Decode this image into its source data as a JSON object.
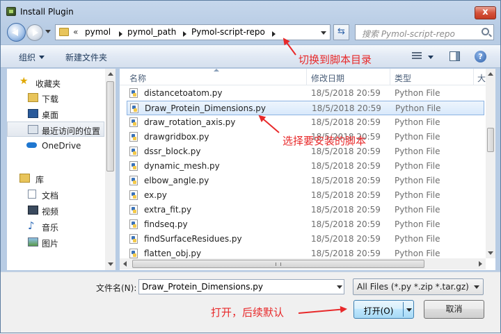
{
  "window": {
    "title": "Install Plugin",
    "close_label": "x"
  },
  "address": {
    "chevrons": "«",
    "crumbs": [
      "pymol",
      "pymol_path",
      "Pymol-script-repo"
    ],
    "search_placeholder": "搜索 Pymol-script-repo"
  },
  "toolbar": {
    "organize_label": "组织",
    "new_folder_label": "新建文件夹",
    "help_label": "?"
  },
  "sidebar": {
    "favorites": "收藏夹",
    "downloads": "下载",
    "desktop": "桌面",
    "recent": "最近访问的位置",
    "onedrive": "OneDrive",
    "libraries": "库",
    "documents": "文档",
    "videos": "视频",
    "music": "音乐",
    "pictures": "图片"
  },
  "columns": {
    "name": "名称",
    "date": "修改日期",
    "type": "类型",
    "size": "大"
  },
  "files": [
    {
      "name": "distancetoatom.py",
      "date": "18/5/2018 20:59",
      "type": "Python File"
    },
    {
      "name": "Draw_Protein_Dimensions.py",
      "date": "18/5/2018 20:59",
      "type": "Python File",
      "selected": true
    },
    {
      "name": "draw_rotation_axis.py",
      "date": "18/5/2018 20:59",
      "type": "Python File"
    },
    {
      "name": "drawgridbox.py",
      "date": "18/5/2018 20:59",
      "type": "Python File"
    },
    {
      "name": "dssr_block.py",
      "date": "18/5/2018 20:59",
      "type": "Python File"
    },
    {
      "name": "dynamic_mesh.py",
      "date": "18/5/2018 20:59",
      "type": "Python File"
    },
    {
      "name": "elbow_angle.py",
      "date": "18/5/2018 20:59",
      "type": "Python File"
    },
    {
      "name": "ex.py",
      "date": "18/5/2018 20:59",
      "type": "Python File"
    },
    {
      "name": "extra_fit.py",
      "date": "18/5/2018 20:59",
      "type": "Python File"
    },
    {
      "name": "findseq.py",
      "date": "18/5/2018 20:59",
      "type": "Python File"
    },
    {
      "name": "findSurfaceResidues.py",
      "date": "18/5/2018 20:59",
      "type": "Python File"
    },
    {
      "name": "flatten_obj.py",
      "date": "18/5/2018 20:59",
      "type": "Python File"
    }
  ],
  "bottom": {
    "filename_label": "文件名(N):",
    "filename_value": "Draw_Protein_Dimensions.py",
    "filter_value": "All Files (*.py *.zip *.tar.gz)",
    "open_label": "打开(O)",
    "cancel_label": "取消"
  },
  "annotations": {
    "switch_dir": "切换到脚本目录",
    "select_script": "选择要安装的脚本",
    "open_default": "打开，后续默认"
  },
  "colors": {
    "annotation": "#e8292a",
    "selection": "#d8e9fb",
    "chrome": "#b8cce4"
  }
}
